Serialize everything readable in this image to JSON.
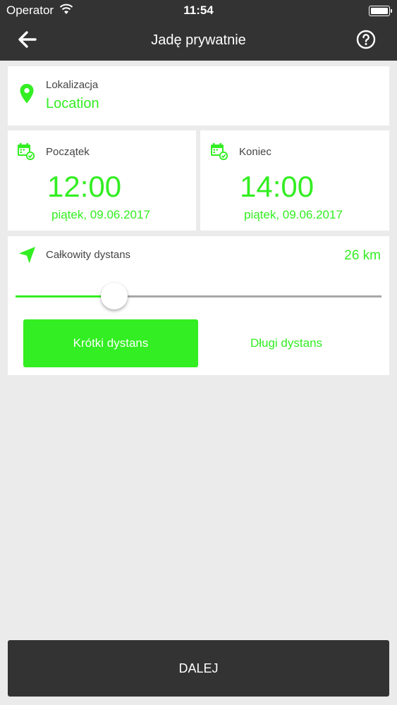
{
  "status_bar": {
    "carrier": "Operator",
    "time": "11:54"
  },
  "header": {
    "title": "Jadę prywatnie"
  },
  "location": {
    "label": "Lokalizacja",
    "value": "Location"
  },
  "start": {
    "label": "Początek",
    "time": "12:00",
    "date": "piątek, 09.06.2017"
  },
  "end": {
    "label": "Koniec",
    "time": "14:00",
    "date": "piątek, 09.06.2017"
  },
  "distance": {
    "label": "Całkowity dystans",
    "value": "26 km",
    "slider_level": 0.25,
    "short_label": "Krótki dystans",
    "long_label": "Długi dystans"
  },
  "footer": {
    "next_label": "DALEJ"
  },
  "colors": {
    "accent": "#33ee22",
    "bar": "#333333",
    "background": "#ebebeb"
  },
  "icons": [
    "wifi-icon",
    "battery-icon",
    "back-arrow-icon",
    "help-icon",
    "location-pin-icon",
    "calendar-icon",
    "navigation-arrow-icon"
  ]
}
